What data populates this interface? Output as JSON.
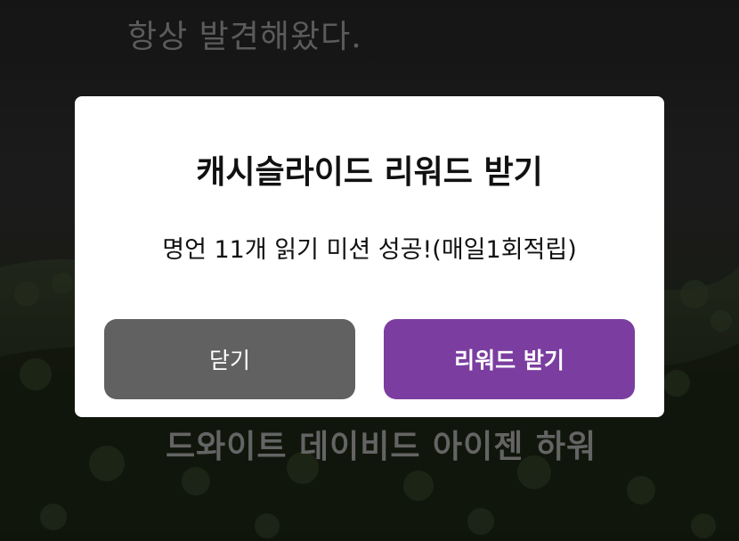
{
  "background": {
    "quote_line": "항상 발견해왔다.",
    "quote_author": "드와이트 데이비드 아이젠 하워"
  },
  "dialog": {
    "title": "캐시슬라이드 리워드 받기",
    "message": "명언 11개 읽기 미션 성공!(매일1회적립)",
    "close_label": "닫기",
    "reward_label": "리워드 받기"
  },
  "colors": {
    "reward_button": "#7b3ea0",
    "close_button": "#616161",
    "dialog_bg": "#ffffff"
  }
}
